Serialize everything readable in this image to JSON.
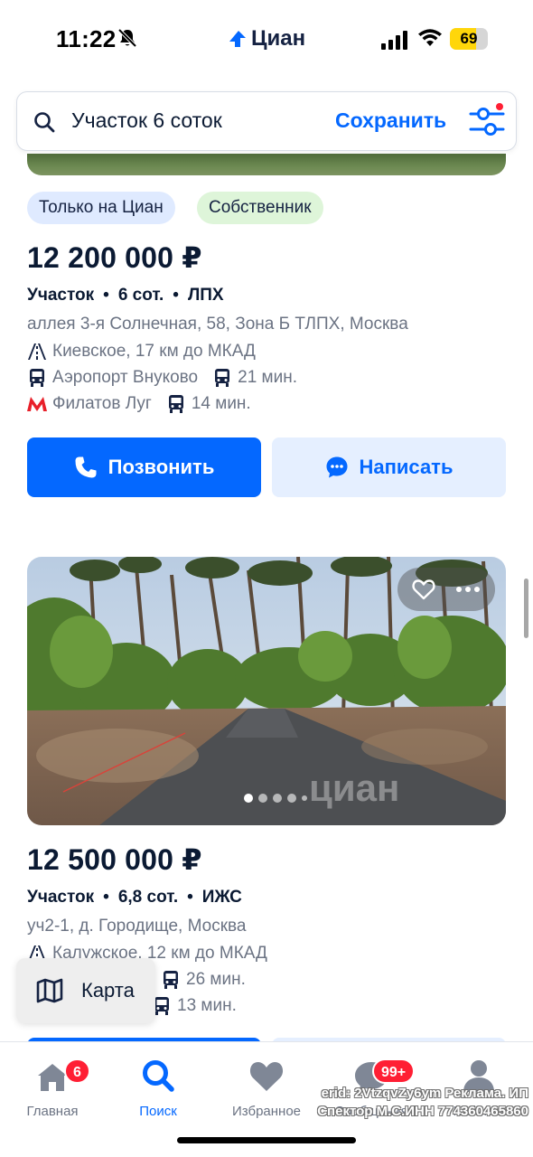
{
  "status_bar": {
    "time": "11:22",
    "battery": "69",
    "battery_level": 0.69
  },
  "app_logo": {
    "text": "Циан"
  },
  "search": {
    "query": "Участок 6 соток",
    "save_label": "Сохранить"
  },
  "listings": [
    {
      "tags": [
        "Только на Циан",
        "Собственник"
      ],
      "price": "12 200 000 ₽",
      "params": [
        "Участок",
        "6 сот.",
        "ЛПХ"
      ],
      "address": "аллея 3-я Солнечная, 58, Зона Б ТЛПХ, Москва",
      "highway": "Киевское, 17 км до МКАД",
      "stations": [
        {
          "name": "Аэропорт Внуково",
          "time": "21 мин.",
          "type": "train"
        },
        {
          "name": "Филатов Луг",
          "time": "14 мин.",
          "type": "metro"
        }
      ],
      "call_label": "Позвонить",
      "write_label": "Написать"
    },
    {
      "price": "12 500 000 ₽",
      "params": [
        "Участок",
        "6,8 сот.",
        "ИЖС"
      ],
      "address": "уч2-1, д. Городище, Москва",
      "highway": "Калужское, 12 км до МКАД",
      "stations": [
        {
          "time": "26 мин."
        },
        {
          "time": "13 мин."
        }
      ],
      "photo_watermark": "циан"
    }
  ],
  "map_button": {
    "label": "Карта"
  },
  "bottom_nav": [
    {
      "label": "Главная",
      "badge": "6"
    },
    {
      "label": "Поиск",
      "active": true
    },
    {
      "label": "Избранное"
    },
    {
      "label": "Сообщения",
      "badge": "99+"
    },
    {
      "label": "Кабинет"
    }
  ],
  "ad_note": {
    "line1": "erid: 2VtzqvZy6ym Реклама. ИП",
    "line2": "Спектор М.С.ИНН 774360465860"
  },
  "colors": {
    "accent": "#0468ff",
    "badge": "#ff1f34",
    "metro": "#e8202a"
  }
}
